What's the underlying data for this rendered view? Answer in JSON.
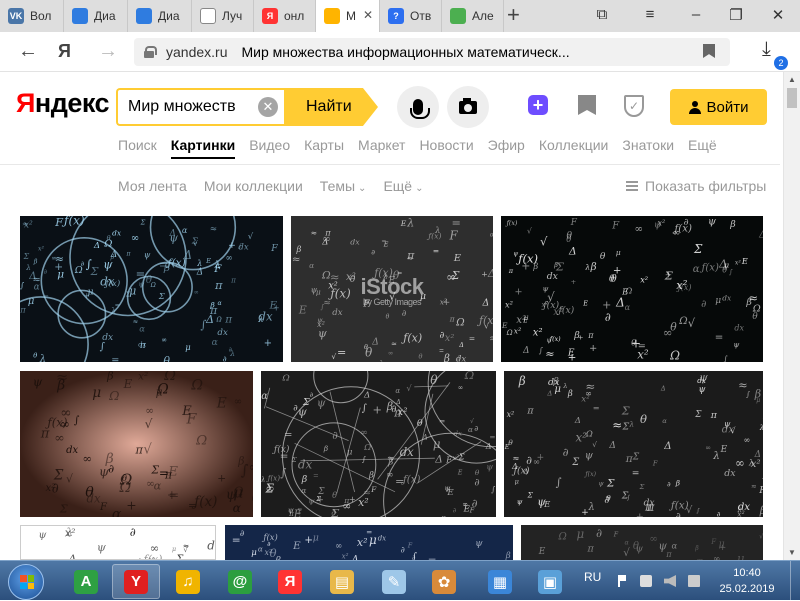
{
  "browser": {
    "tabs": [
      {
        "label": "Вол",
        "favicon": "vk-icon",
        "color": "#4a76a8",
        "glyph": "VK"
      },
      {
        "label": "Диа",
        "favicon": "chat-icon",
        "color": "#2f7ce0",
        "glyph": ""
      },
      {
        "label": "Диа",
        "favicon": "chat-icon",
        "color": "#2f7ce0",
        "glyph": ""
      },
      {
        "label": "Луч",
        "favicon": "page-icon",
        "color": "#ffffff",
        "glyph": ""
      },
      {
        "label": "онл",
        "favicon": "yandex-icon",
        "color": "#ff3333",
        "glyph": "Я"
      },
      {
        "label": "М",
        "favicon": "images-icon",
        "color": "#ffb400",
        "glyph": "",
        "active": true
      },
      {
        "label": "Отв",
        "favicon": "question-icon",
        "color": "#2d6ff0",
        "glyph": "?"
      },
      {
        "label": "Але",
        "favicon": "alice-icon",
        "color": "#4caf50",
        "glyph": ""
      }
    ],
    "url_host": "yandex.ru",
    "page_title": "Мир множества информационных математическ...",
    "downloads_count": "2"
  },
  "yandex": {
    "logo_first": "Я",
    "logo_rest": "ндекс",
    "search_query": "Мир множеств",
    "find_label": "Найти",
    "clear_glyph": "✕",
    "login_label": "Войти",
    "services": [
      {
        "label": "Поиск"
      },
      {
        "label": "Картинки",
        "active": true
      },
      {
        "label": "Видео"
      },
      {
        "label": "Карты"
      },
      {
        "label": "Маркет"
      },
      {
        "label": "Новости"
      },
      {
        "label": "Эфир"
      },
      {
        "label": "Коллекции"
      },
      {
        "label": "Знатоки"
      },
      {
        "label": "Ещё"
      }
    ],
    "subnav": [
      {
        "label": "Моя лента",
        "chevron": false
      },
      {
        "label": "Мои коллекции",
        "chevron": false
      },
      {
        "label": "Темы",
        "chevron": true
      },
      {
        "label": "Ещё",
        "chevron": true
      }
    ],
    "filters_label": "Показать фильтры"
  },
  "images": [
    {
      "name": "image-math-circles",
      "theme": "circles",
      "bg": "#0a1016",
      "fg": "#9fd2ec"
    },
    {
      "name": "image-istock-equations",
      "theme": "blackboard",
      "bg": "#2e2e2e",
      "fg": "#d8d8d8",
      "watermark": "iStock",
      "watermark_sub": "by Getty Images"
    },
    {
      "name": "image-physics-formulas",
      "theme": "formulas",
      "bg": "#060909",
      "fg": "#e8e8e8"
    },
    {
      "name": "image-sepia-equations",
      "theme": "sepia",
      "bg": "#5a3a30",
      "fg": "#1b0f0b"
    },
    {
      "name": "image-geometry-sketches",
      "theme": "geometry",
      "bg": "#1c1c1c",
      "fg": "#cfcfcf"
    },
    {
      "name": "image-floating-formulas",
      "theme": "floating",
      "bg": "#1b1b1b",
      "fg": "#e0e0e0"
    },
    {
      "name": "image-white-formulas",
      "theme": "white",
      "bg": "#ffffff",
      "fg": "#222222"
    },
    {
      "name": "image-blue-formulas",
      "theme": "blue",
      "bg": "#0d1628",
      "fg": "#e8eef8"
    },
    {
      "name": "image-dark-board",
      "theme": "darkboard",
      "bg": "#232323",
      "fg": "#8a8a8a"
    }
  ],
  "taskbar": {
    "apps": [
      {
        "name": "taskbar-aimp-app",
        "glyph": "A",
        "color": "#2ea043",
        "open": false
      },
      {
        "name": "taskbar-yandex-browser-app",
        "glyph": "Y",
        "color": "#e02020",
        "open": true
      },
      {
        "name": "taskbar-music-app",
        "glyph": "♫",
        "color": "#f0b400",
        "open": false
      },
      {
        "name": "taskbar-mail-agent-app",
        "glyph": "@",
        "color": "#2c9e3f",
        "open": false
      },
      {
        "name": "taskbar-yandex-app",
        "glyph": "Я",
        "color": "#ff3333",
        "open": false
      },
      {
        "name": "taskbar-explorer-app",
        "glyph": "▤",
        "color": "#e8b84a",
        "open": false
      },
      {
        "name": "taskbar-notepad-app",
        "glyph": "✎",
        "color": "#9ec7e8",
        "open": false
      },
      {
        "name": "taskbar-paint-app",
        "glyph": "✿",
        "color": "#d88a3a",
        "open": false
      },
      {
        "name": "taskbar-control-panel-app",
        "glyph": "▦",
        "color": "#3b86d8",
        "open": false
      },
      {
        "name": "taskbar-photos-app",
        "glyph": "▣",
        "color": "#5aa0d8",
        "open": false
      }
    ],
    "language": "RU",
    "time": "10:40",
    "date": "25.02.2019"
  }
}
